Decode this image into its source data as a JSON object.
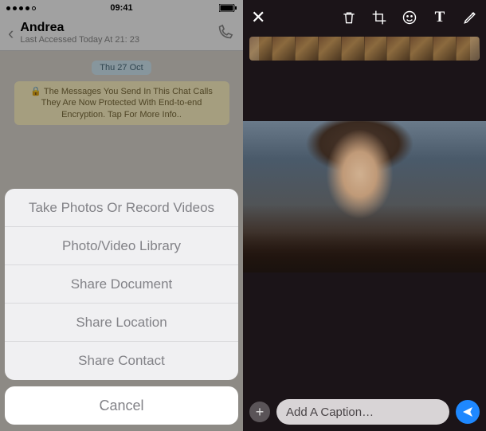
{
  "status_bar": {
    "time": "09:41"
  },
  "chat_header": {
    "name": "Andrea",
    "subtitle": "Last Accessed Today At 21: 23"
  },
  "chat_body": {
    "date_label": "Thu 27 Oct",
    "encryption_notice": "The Messages You Send In This Chat Calls They Are Now Protected With End-to-end Encryption. Tap For More Info.."
  },
  "action_sheet": {
    "items": [
      "Take Photos Or Record Videos",
      "Photo/Video Library",
      "Share Document",
      "Share Location",
      "Share Contact"
    ],
    "cancel": "Cancel"
  },
  "editor": {
    "caption_placeholder": "Add A Caption…"
  }
}
